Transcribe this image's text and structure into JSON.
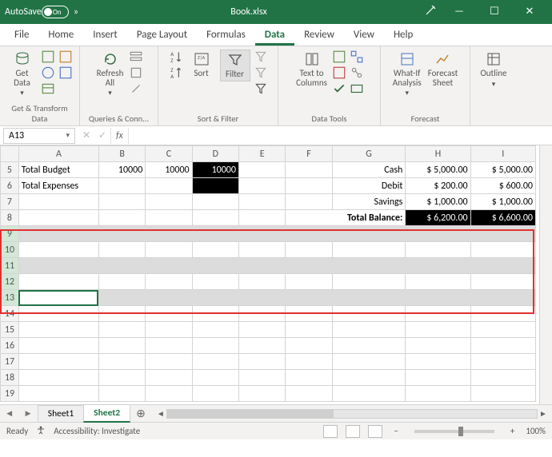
{
  "titlebar": {
    "autosave_label": "AutoSave",
    "autosave_state": "On",
    "chevron": "»",
    "book_title": "Book.xlsx",
    "min": "—",
    "max": "☐",
    "close": "✕"
  },
  "tabs": {
    "file": "File",
    "home": "Home",
    "insert": "Insert",
    "page_layout": "Page Layout",
    "formulas": "Formulas",
    "data": "Data",
    "review": "Review",
    "view": "View",
    "help": "Help"
  },
  "ribbon": {
    "get_data": "Get\nData",
    "group_getdata": "Get & Transform Data",
    "refresh": "Refresh\nAll",
    "group_queries": "Queries & Conn...",
    "sort": "Sort",
    "filter": "Filter",
    "group_sortfilter": "Sort & Filter",
    "text_to_columns": "Text to\nColumns",
    "group_datatools": "Data Tools",
    "whatif": "What-If\nAnalysis",
    "forecast_sheet": "Forecast\nSheet",
    "group_forecast": "Forecast",
    "outline": "Outline"
  },
  "fbar": {
    "namebox": "A13",
    "cancel": "✕",
    "enter": "✓",
    "fx": "fx",
    "formula": ""
  },
  "cols": {
    "A": "A",
    "B": "B",
    "C": "C",
    "D": "D",
    "E": "E",
    "F": "F",
    "G": "G",
    "H": "H",
    "I": "I"
  },
  "rows": {
    "5": "5",
    "6": "6",
    "7": "7",
    "8": "8",
    "9": "9",
    "10": "10",
    "11": "11",
    "12": "12",
    "13": "13",
    "14": "14",
    "15": "15",
    "16": "16",
    "17": "17",
    "18": "18",
    "19": "19"
  },
  "cells": {
    "A5": "Total Budget",
    "B5": "10000",
    "C5": "10000",
    "D5": "10000",
    "G5": "Cash",
    "H5": "$  5,000.00",
    "I5": "$  5,000.00",
    "A6": "Total Expenses",
    "G6": "Debit",
    "H6": "$     200.00",
    "I6": "$     600.00",
    "G7": "Savings",
    "H7": "$  1,000.00",
    "I7": "$  1,000.00",
    "G8": "Total Balance:",
    "H8": "$  6,200.00",
    "I8": "$  6,600.00"
  },
  "sheets": {
    "nav_prev": "◄",
    "nav_next": "►",
    "sheet1": "Sheet1",
    "sheet2": "Sheet2",
    "add": "⊕"
  },
  "statusbar": {
    "ready": "Ready",
    "accessibility": "Accessibility: Investigate",
    "zoom_minus": "−",
    "zoom_plus": "+",
    "zoom_value": "100%"
  }
}
